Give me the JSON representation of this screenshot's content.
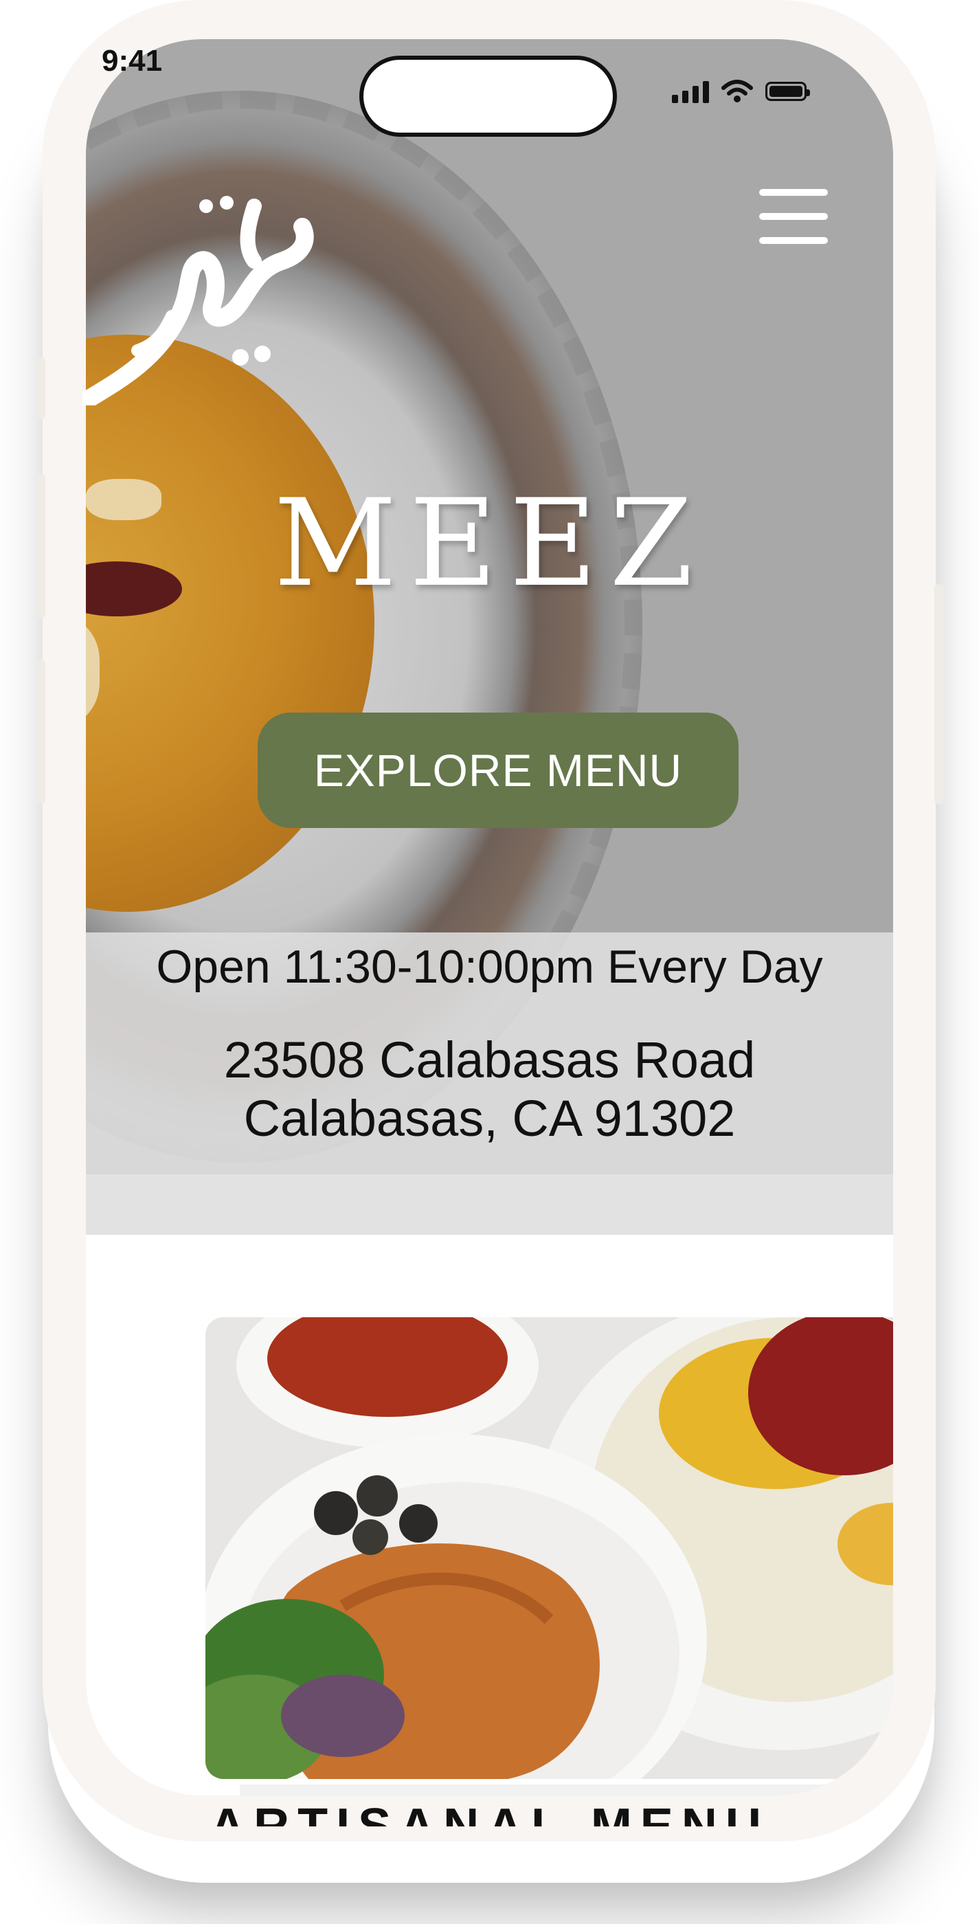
{
  "status_bar": {
    "time": "9:41"
  },
  "hero": {
    "brand_name": "MEEZ",
    "explore_button": "EXPLORE MENU"
  },
  "info": {
    "hours": "Open 11:30-10:00pm Every Day",
    "address_line1": "23508 Calabasas Road",
    "address_line2": "Calabasas, CA 91302"
  },
  "menu_section": {
    "title": "ARTISANAL MENU"
  },
  "colors": {
    "accent_green": "#66774b",
    "frame": "#f8f5f2",
    "info_band": "#dedede"
  },
  "icons": [
    "menu-hamburger-icon",
    "cellular-signal-icon",
    "wifi-icon",
    "battery-icon",
    "calligraphy-logo"
  ]
}
